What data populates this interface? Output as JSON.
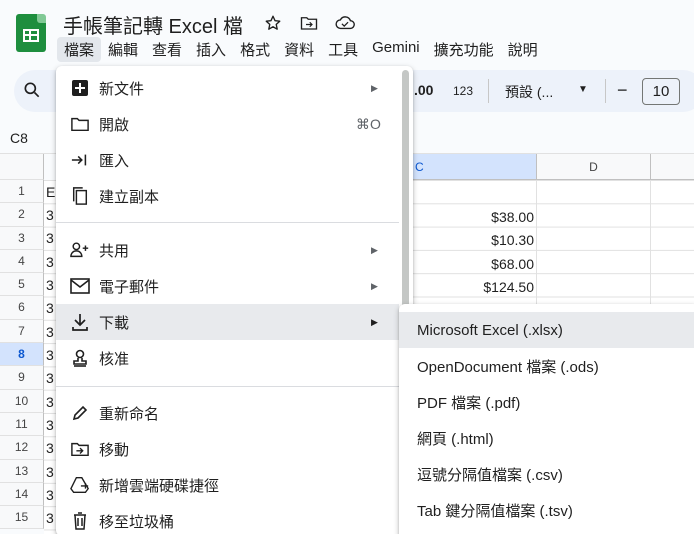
{
  "app": {
    "title": "手帳筆記轉 Excel 檔"
  },
  "title_icons": [
    "star-icon",
    "move-to-folder-icon",
    "cloud-saved-icon"
  ],
  "menubar": [
    "檔案",
    "編輯",
    "查看",
    "插入",
    "格式",
    "資料",
    "工具",
    "Gemini",
    "擴充功能",
    "說明"
  ],
  "toolbar": {
    "decimal_label": ".00",
    "number_format": "123",
    "font_label": "預設 (...",
    "font_size": "10",
    "minus_label": "−"
  },
  "name_box": "C8",
  "grid": {
    "col_headers": [
      "C",
      "D"
    ],
    "row_numbers": [
      "1",
      "2",
      "3",
      "4",
      "5",
      "6",
      "7",
      "8",
      "9",
      "10",
      "11",
      "12",
      "13",
      "14",
      "15"
    ],
    "selected_row": "8",
    "col_a_fragments": [
      "E",
      "3",
      "3",
      "3",
      "3",
      "3",
      "3",
      "3",
      "3",
      "3",
      "3",
      "3",
      "3",
      "3",
      "3"
    ],
    "amounts": [
      "$38.00",
      "$10.30",
      "$68.00",
      "$124.50"
    ]
  },
  "file_menu": {
    "items": [
      {
        "label": "新文件",
        "icon": "new-doc-icon",
        "submenu": true
      },
      {
        "label": "開啟",
        "icon": "folder-open-icon",
        "shortcut": "⌘O"
      },
      {
        "label": "匯入",
        "icon": "import-icon"
      },
      {
        "label": "建立副本",
        "icon": "copy-icon"
      },
      {
        "label": "共用",
        "icon": "share-person-icon",
        "submenu": true
      },
      {
        "label": "電子郵件",
        "icon": "email-icon",
        "submenu": true
      },
      {
        "label": "下載",
        "icon": "download-icon",
        "submenu": true,
        "active": true
      },
      {
        "label": "核准",
        "icon": "approval-icon"
      },
      {
        "label": "重新命名",
        "icon": "rename-pencil-icon"
      },
      {
        "label": "移動",
        "icon": "move-folder-icon"
      },
      {
        "label": "新增雲端硬碟捷徑",
        "icon": "drive-shortcut-icon"
      },
      {
        "label": "移至垃圾桶",
        "icon": "trash-icon"
      }
    ]
  },
  "download_menu": {
    "items": [
      "Microsoft Excel (.xlsx)",
      "OpenDocument 檔案 (.ods)",
      "PDF 檔案 (.pdf)",
      "網頁 (.html)",
      "逗號分隔值檔案 (.csv)",
      "Tab 鍵分隔值檔案 (.tsv)"
    ]
  }
}
